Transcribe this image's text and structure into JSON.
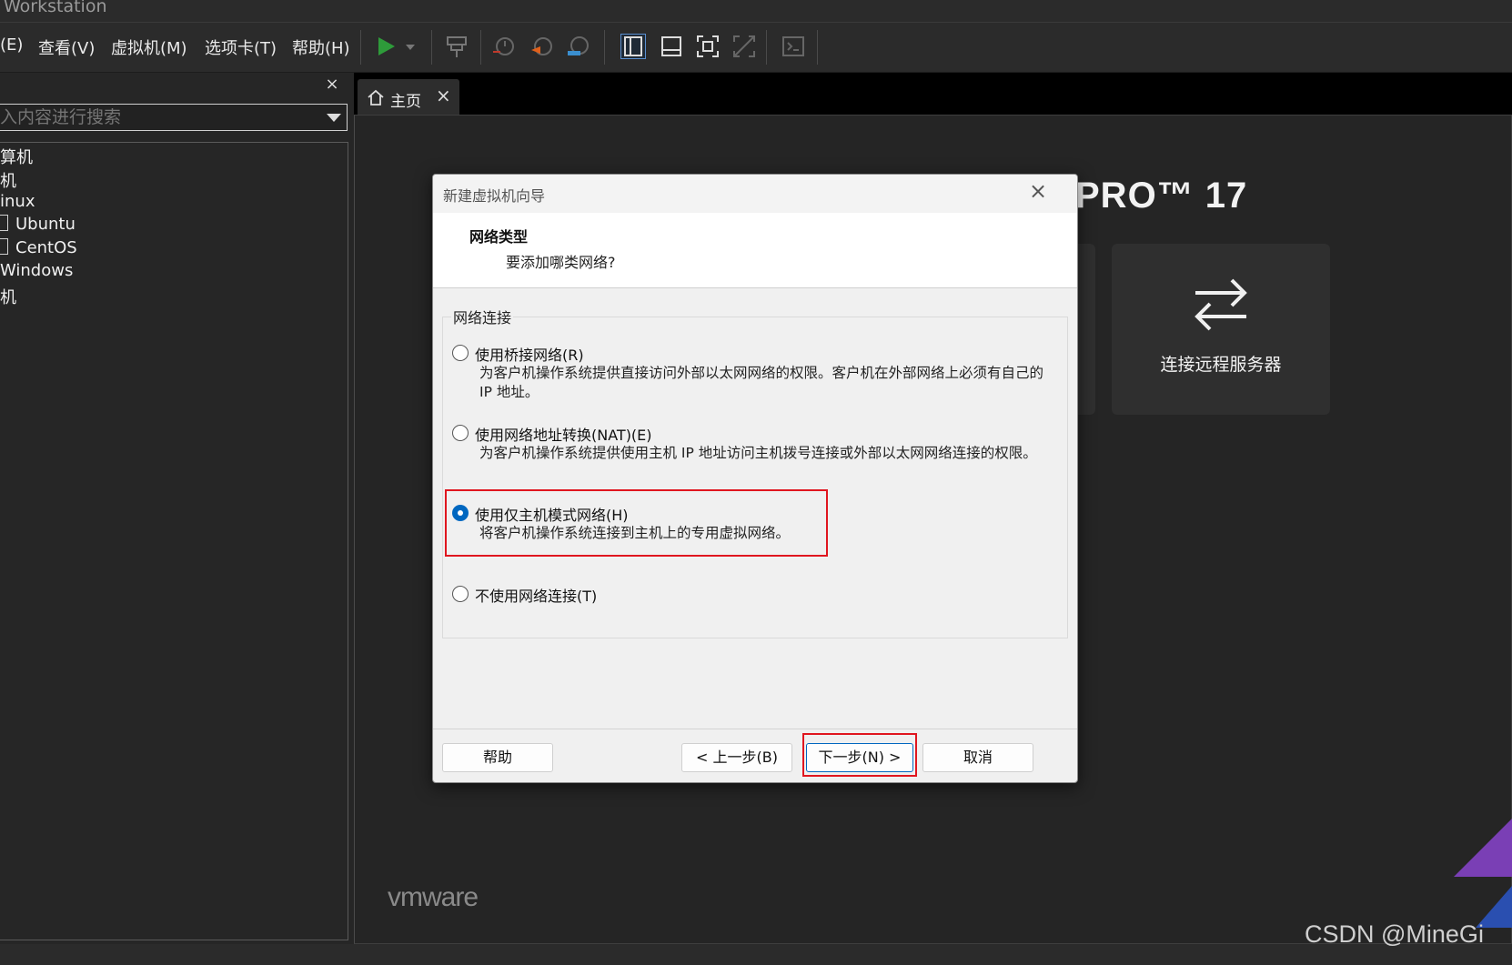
{
  "window": {
    "title": "Workstation"
  },
  "menu": [
    "(E)",
    "查看(V)",
    "虚拟机(M)",
    "选项卡(T)",
    "帮助(H)"
  ],
  "sidebar": {
    "search_placeholder": "入内容进行搜索",
    "close": "×",
    "tree": [
      "算机",
      "机",
      "inux",
      "Ubuntu",
      "CentOS",
      "Windows",
      "机"
    ]
  },
  "tabs": [
    {
      "label": "主页",
      "close": "×"
    }
  ],
  "home": {
    "brand_title": "PRO™ 17",
    "remote_card": {
      "label": "连接远程服务器"
    },
    "vmware_logo": "vmware",
    "watermark": "CSDN @MineGi"
  },
  "dialog": {
    "title": "新建虚拟机向导",
    "close": "×",
    "heading": "网络类型",
    "subheading": "要添加哪类网络?",
    "group_label": "网络连接",
    "options": [
      {
        "label": "使用桥接网络(R)",
        "desc": "为客户机操作系统提供直接访问外部以太网网络的权限。客户机在外部网络上必须有自己的 IP 地址。",
        "checked": false
      },
      {
        "label": "使用网络地址转换(NAT)(E)",
        "desc": "为客户机操作系统提供使用主机 IP 地址访问主机拨号连接或外部以太网网络连接的权限。",
        "checked": false
      },
      {
        "label": "使用仅主机模式网络(H)",
        "desc": "将客户机操作系统连接到主机上的专用虚拟网络。",
        "checked": true
      },
      {
        "label": "不使用网络连接(T)",
        "desc": "",
        "checked": false
      }
    ],
    "buttons": {
      "help": "帮助",
      "back": "< 上一步(B)",
      "next": "下一步(N) >",
      "cancel": "取消"
    }
  },
  "colors": {
    "accent": "#0067c0",
    "highlight": "#e0161f",
    "play": "#2e9b3a"
  }
}
